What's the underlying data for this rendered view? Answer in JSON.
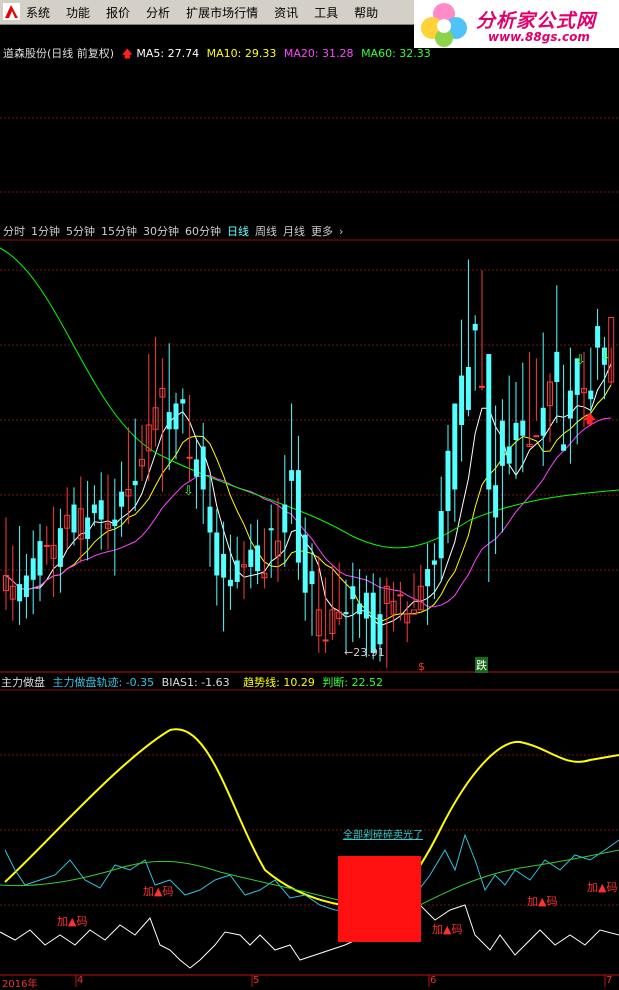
{
  "menu": {
    "items": [
      "系统",
      "功能",
      "报价",
      "分析",
      "扩展市场行情",
      "资讯",
      "工具",
      "帮助"
    ]
  },
  "brand": {
    "name": "分析家公式网",
    "url": "www.88gs.com"
  },
  "stock": {
    "title": "道森股份(日线 前复权)",
    "ma5": "MA5: 27.74",
    "ma10": "MA10: 29.33",
    "ma20": "MA20: 31.28",
    "ma60": "MA60: 32.33",
    "colors": {
      "ma5": "#ffffff",
      "ma10": "#ffff00",
      "ma20": "#ff44ff",
      "ma60": "#00ff00"
    }
  },
  "tabs": {
    "items": [
      "分时",
      "1分钟",
      "5分钟",
      "15分钟",
      "30分钟",
      "60分钟",
      "日线",
      "周线",
      "月线",
      "更多",
      "›"
    ],
    "active_index": 6
  },
  "price": {
    "low_label": "23.91",
    "signal_s": "$",
    "signal_fall": "跌"
  },
  "indicator": {
    "name": "主力做盘",
    "track": "主力做盘轨迹: -0.35",
    "bias": "BIAS1: -1.63",
    "trend": "趋势线: 10.29",
    "judge": "判断: 22.52",
    "notes": [
      "加▲码",
      "加▲码",
      "加▲码",
      "加▲码",
      "加▲码"
    ],
    "banner": "全部剁碎碎卖光了"
  },
  "xaxis": {
    "labels": [
      "2016年",
      "4",
      "5",
      "6",
      "7"
    ]
  },
  "chart_data": {
    "type": "candlestick",
    "up_color": "#ff3b3b",
    "down_color": "#54ffff",
    "candles": [
      [
        23,
        30,
        48,
        51,
        20
      ],
      [
        19,
        25,
        17,
        38,
        15
      ],
      [
        26,
        18,
        30,
        47,
        13
      ],
      [
        30,
        20,
        28,
        34,
        16
      ],
      [
        38,
        28,
        22,
        45,
        18
      ],
      [
        46,
        30,
        22,
        48,
        24
      ],
      [
        44,
        44,
        44,
        47,
        41
      ],
      [
        38,
        44,
        34,
        56,
        26
      ],
      [
        52,
        34,
        52,
        55,
        28
      ],
      [
        52,
        58,
        50,
        65,
        48
      ],
      [
        63,
        50,
        50,
        65,
        50
      ],
      [
        47,
        61,
        45,
        70,
        42
      ],
      [
        57,
        47,
        57,
        68,
        43
      ],
      [
        63,
        59,
        63,
        66,
        59
      ],
      [
        65,
        56,
        51,
        72,
        48
      ],
      [
        52,
        54,
        57,
        71,
        48
      ],
      [
        56,
        53,
        41,
        69,
        36
      ],
      [
        69,
        62,
        70,
        77,
        54
      ],
      [
        67,
        70,
        80,
        93,
        60
      ],
      [
        74,
        72,
        80,
        97,
        66
      ],
      [
        81,
        84,
        82,
        94,
        80
      ],
      [
        88,
        100,
        101,
        127,
        80
      ],
      [
        98,
        108,
        101,
        135,
        96
      ],
      [
        113,
        117,
        103,
        125,
        75
      ],
      [
        106,
        98,
        93,
        132,
        85
      ],
      [
        110,
        98,
        99,
        109,
        90
      ],
      [
        112,
        110,
        105,
        111,
        102
      ],
      [
        85,
        85,
        104,
        108,
        80
      ],
      [
        84,
        76,
        72,
        88,
        67
      ],
      [
        90,
        70,
        62,
        95,
        60
      ],
      [
        62,
        50,
        50,
        70,
        40
      ],
      [
        50,
        30,
        48,
        55,
        22
      ],
      [
        40,
        29,
        44,
        49,
        10
      ],
      [
        28,
        25,
        25,
        43,
        20
      ],
      [
        37,
        27,
        30,
        42,
        30
      ],
      [
        34,
        35,
        35,
        40,
        25
      ],
      [
        42,
        34,
        42,
        48,
        30
      ],
      [
        44,
        32,
        30,
        50,
        32
      ],
      [
        29,
        31,
        44,
        46,
        30
      ],
      [
        52,
        51,
        51,
        57,
        35
      ],
      [
        39,
        46,
        55,
        60,
        33
      ],
      [
        63,
        50,
        67,
        80,
        40
      ],
      [
        79,
        74,
        74,
        104,
        60
      ],
      [
        79,
        36,
        67,
        89,
        34
      ],
      [
        49,
        22,
        22,
        51,
        15
      ],
      [
        32,
        26,
        13,
        39,
        8
      ],
      [
        2,
        14,
        2,
        33,
        0
      ],
      [
        0,
        0,
        14,
        23,
        0
      ],
      [
        3,
        14,
        11,
        29,
        6
      ],
      [
        10,
        13,
        6,
        30,
        13
      ],
      [
        13,
        12,
        12,
        22,
        1
      ],
      [
        25,
        19,
        2,
        30,
        5
      ],
      [
        17,
        12,
        9,
        27,
        7
      ],
      [
        22,
        10,
        5,
        24,
        -2
      ],
      [
        22,
        -6,
        17,
        25,
        -3
      ],
      [
        12,
        -2,
        12,
        23,
        -4
      ],
      [
        17,
        25,
        19,
        23,
        -7
      ],
      [
        12,
        18,
        18,
        21,
        10
      ],
      [
        21,
        21,
        21,
        21,
        15
      ],
      [
        8,
        12,
        13,
        12,
        5
      ],
      [
        12,
        14,
        21,
        25,
        21
      ],
      [
        14,
        25,
        14,
        29,
        20
      ],
      [
        33,
        25,
        25,
        39,
        13
      ],
      [
        37,
        35,
        37,
        39,
        25
      ],
      [
        60,
        38,
        28,
        70,
        33
      ],
      [
        88,
        60,
        61,
        94,
        51
      ],
      [
        110,
        70,
        61,
        92,
        61
      ],
      [
        123,
        100,
        112,
        143,
        89
      ],
      [
        127,
        107,
        129,
        171,
        110
      ],
      [
        147,
        144,
        116,
        145,
        122
      ],
      [
        118,
        118,
        75,
        166,
        122
      ],
      [
        133,
        70,
        44,
        121,
        33
      ],
      [
        72,
        57,
        65,
        103,
        46
      ],
      [
        102,
        81,
        41,
        106,
        56
      ],
      [
        90,
        82,
        65,
        117,
        83
      ],
      [
        101,
        93,
        83,
        114,
        81
      ],
      [
        102,
        95,
        99,
        123,
        84
      ],
      [
        90,
        91,
        103,
        128,
        96
      ],
      [
        95,
        95,
        124,
        125,
        108
      ],
      [
        108,
        95,
        104,
        137,
        87
      ],
      [
        109,
        120,
        103,
        118,
        98
      ],
      [
        134,
        120,
        125,
        159,
        107
      ],
      [
        91,
        88,
        114,
        122,
        97
      ],
      [
        116,
        103,
        112,
        130,
        88
      ],
      [
        131,
        114,
        107,
        123,
        97
      ],
      [
        115,
        117,
        114,
        128,
        105
      ],
      [
        116,
        112,
        117,
        130,
        107
      ],
      [
        146,
        136,
        143,
        148,
        127
      ],
      [
        136,
        128,
        126,
        135,
        118
      ],
      [
        120,
        150,
        125,
        130,
        125
      ]
    ],
    "series": [
      {
        "name": "MA5",
        "color": "#ffffff"
      },
      {
        "name": "MA10",
        "color": "#ffff00"
      },
      {
        "name": "MA20",
        "color": "#ff44ff"
      },
      {
        "name": "MA60",
        "color": "#00ff00"
      }
    ],
    "indicator_series": [
      {
        "name": "主力做盘轨迹",
        "color": "#ffff00"
      },
      {
        "name": "BIAS1",
        "color": "#2fc4e0"
      },
      {
        "name": "趋势线",
        "color": "#33cc33"
      },
      {
        "name": "判断",
        "color": "#ffffff"
      }
    ]
  }
}
